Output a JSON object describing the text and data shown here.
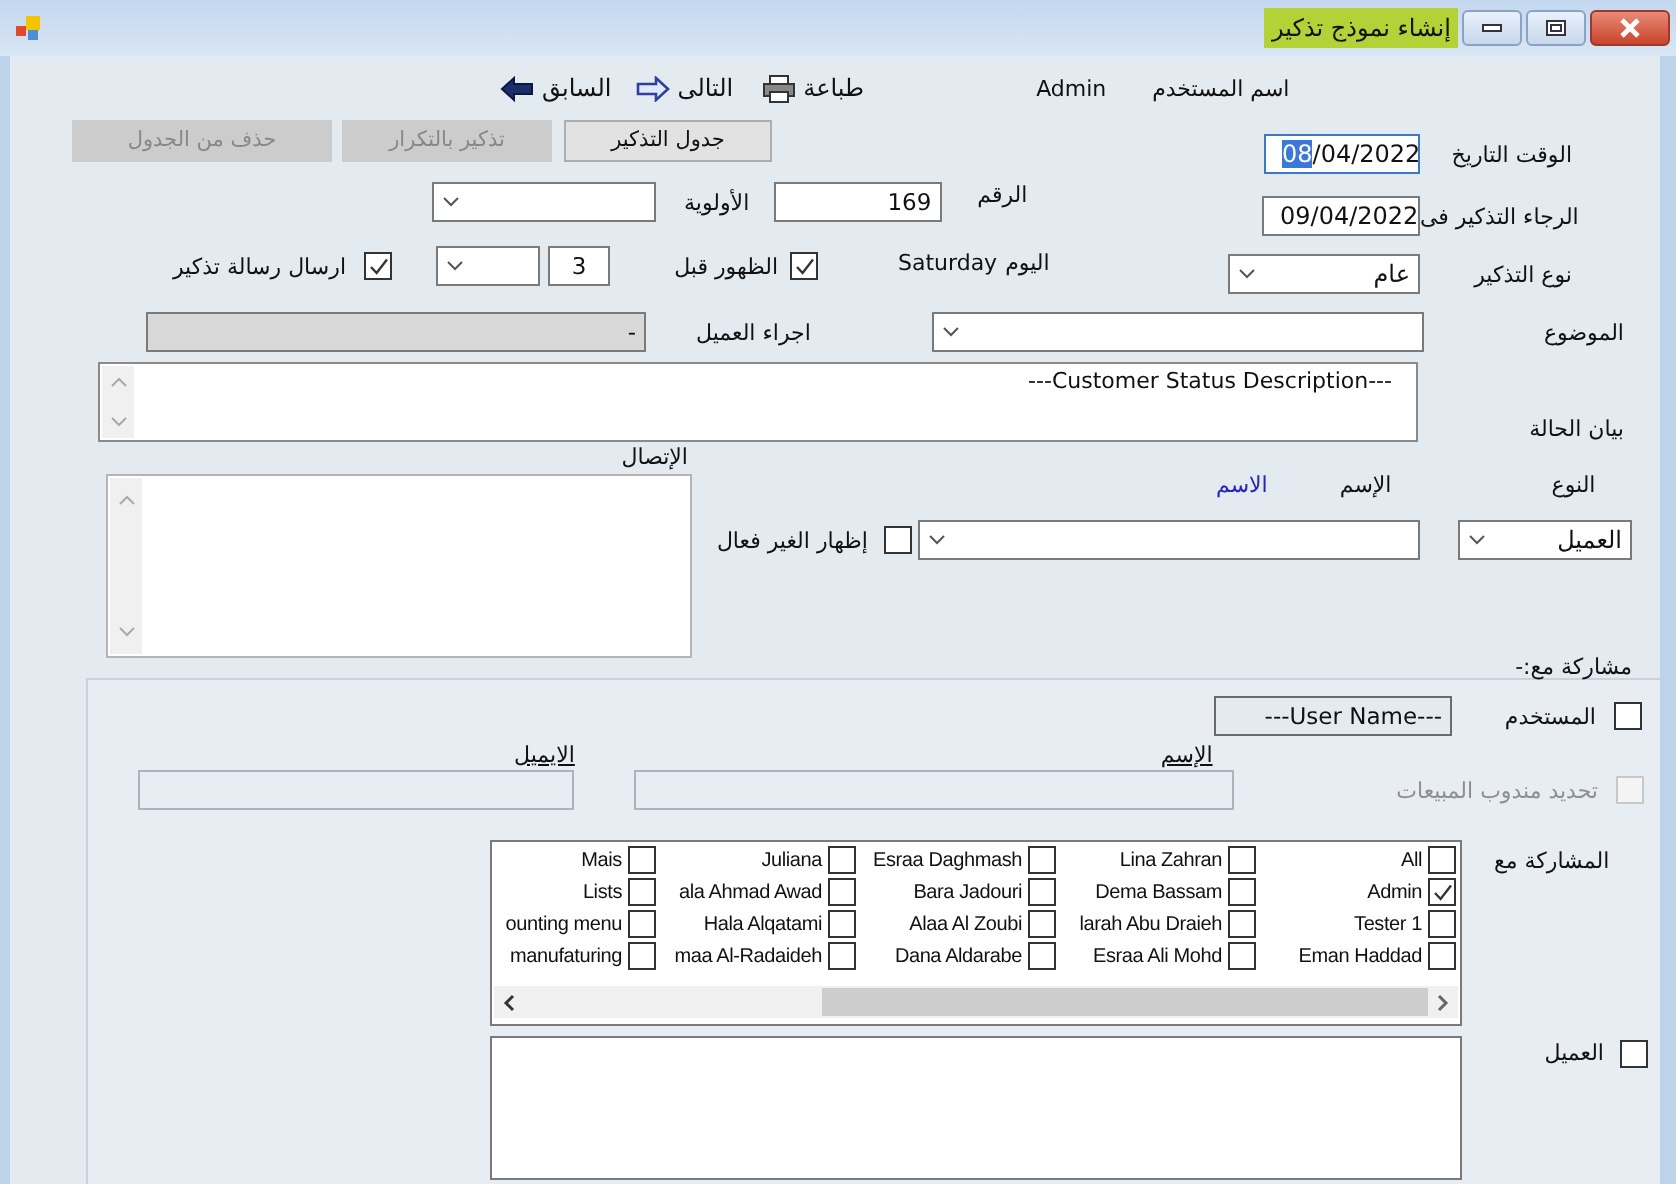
{
  "window": {
    "title": "إنشاء نموذج تذكير"
  },
  "toolbar": {
    "previous": "السابق",
    "next": "التالى",
    "print": "طباعة",
    "user_value": "Admin",
    "user_label": "اسم المستخدم"
  },
  "tab_buttons": [
    {
      "label": "جدول التذكير",
      "disabled": false
    },
    {
      "label": "تذكير بالتكرار",
      "disabled": true
    },
    {
      "label": "حذف من الجدول",
      "disabled": true
    }
  ],
  "date_time": {
    "label": "الوقت التاريخ",
    "value_selected": "08",
    "value_rest": "/04/2022"
  },
  "remind_on": {
    "label": "الرجاء التذكير فى",
    "value": "09/04/2022"
  },
  "number": {
    "label": "الرقم",
    "value": "169"
  },
  "priority": {
    "label": "الأولوية"
  },
  "day": {
    "label": "اليوم",
    "value": "Saturday"
  },
  "show_before": {
    "label": "الظهور قبل",
    "checked": true,
    "value": "3"
  },
  "send_message": {
    "label": "ارسال رسالة تذكير",
    "checked": true
  },
  "reminder_type": {
    "label": "نوع التذكير",
    "value": "عام"
  },
  "subject": {
    "label": "الموضوع"
  },
  "customer_action": {
    "label": "اجراء العميل",
    "value": "-",
    "disabled": true
  },
  "status": {
    "label": "بيان الحالة",
    "value": "---Customer Status Description---"
  },
  "contact": {
    "label": "الإتصال"
  },
  "type": {
    "label": "النوع",
    "value": "العميل"
  },
  "name": {
    "label": "الإسم",
    "link": "الاسم"
  },
  "show_inactive": {
    "label": "إظهار الغير فعال",
    "checked": false
  },
  "sharing": {
    "title": "مشاركة مع:-",
    "user": {
      "label": "المستخدم",
      "checked": false,
      "value": "---User Name---"
    },
    "email_header": "الايميل",
    "name_header": "الإسم",
    "sales_rep": {
      "label": "تحديد مندوب المبيعات",
      "checked": false,
      "disabled": true
    },
    "share_with_label": "المشاركة مع",
    "users": [
      {
        "name": "All",
        "checked": false
      },
      {
        "name": "Lina Zahran",
        "checked": false
      },
      {
        "name": "Esraa Daghmash",
        "checked": false
      },
      {
        "name": "Juliana",
        "checked": false
      },
      {
        "name": "Mais",
        "checked": false
      },
      {
        "name": "Admin",
        "checked": true
      },
      {
        "name": "Dema Bassam",
        "checked": false
      },
      {
        "name": "Bara Jadouri",
        "checked": false
      },
      {
        "name": "ala Ahmad Awad",
        "checked": false
      },
      {
        "name": "Lists",
        "checked": false
      },
      {
        "name": "Tester 1",
        "checked": false
      },
      {
        "name": "larah Abu Draieh",
        "checked": false
      },
      {
        "name": "Alaa Al Zoubi",
        "checked": false
      },
      {
        "name": "Hala Alqatami",
        "checked": false
      },
      {
        "name": "ounting menu",
        "checked": false
      },
      {
        "name": "Eman Haddad",
        "checked": false
      },
      {
        "name": "Esraa Ali Mohd",
        "checked": false
      },
      {
        "name": "Dana Aldarabe",
        "checked": false
      },
      {
        "name": "maa Al-Radaideh",
        "checked": false
      },
      {
        "name": "manufaturing",
        "checked": false
      }
    ],
    "customer": {
      "label": "العميل",
      "checked": false
    }
  }
}
